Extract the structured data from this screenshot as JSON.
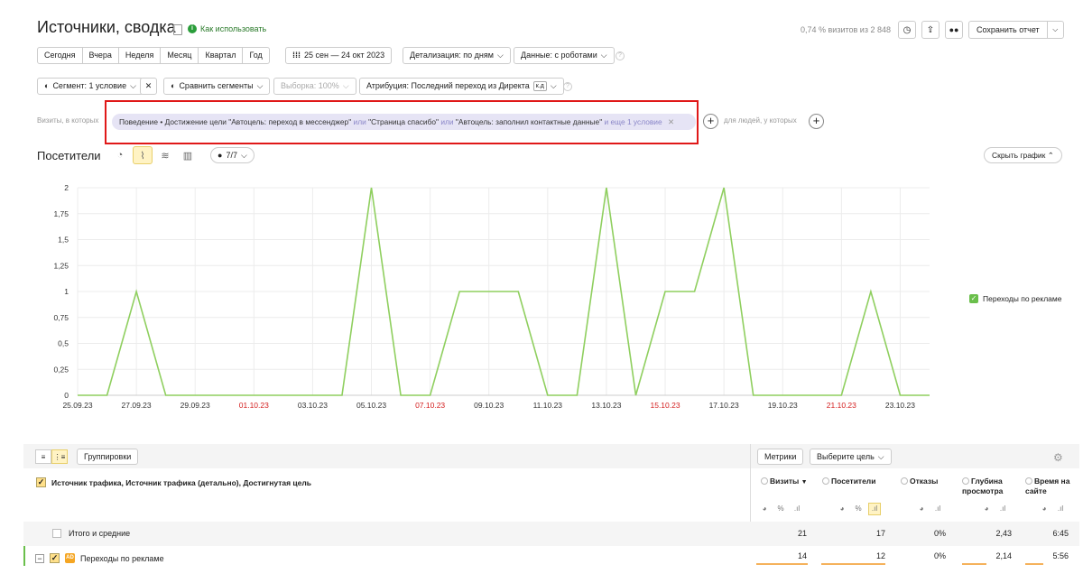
{
  "header": {
    "title": "Источники, сводка",
    "help_link": "Как использовать",
    "visits_note": "0,74 % визитов из 2 848",
    "save_label": "Сохранить отчет"
  },
  "periods": [
    "Сегодня",
    "Вчера",
    "Неделя",
    "Месяц",
    "Квартал",
    "Год"
  ],
  "date_range": "25 сен — 24 окт 2023",
  "detail": "Детализация: по дням",
  "data_mode": "Данные: с роботами",
  "segment": "Сегмент: 1 условие",
  "compare": "Сравнить сегменты",
  "sample": "Выборка: 100%",
  "attribution": "Атрибуция: Последний переход из Директа",
  "attribution_badge": "к.д",
  "filter": {
    "label": "Визиты, в которых",
    "chip_part1": "Поведение • Достижение цели \"Автоцель: переход в мессенджер\" ",
    "or1": "или",
    "chip_part2": " \"Страница спасибо\" ",
    "or2": "или",
    "chip_part3": " \"Автоцель: заполнил контактные данные\" ",
    "more": "и еще 1 условие",
    "people_label": "для людей, у которых"
  },
  "graph": {
    "title": "Посетители",
    "series_count": "7/7",
    "hide_label": "Скрыть график",
    "legend": "Переходы по рекламе",
    "line_color": "#8fcf5f"
  },
  "chart_data": {
    "type": "line",
    "ylim": [
      0,
      2
    ],
    "yticks": [
      "0",
      "0,25",
      "0,5",
      "0,75",
      "1",
      "1,25",
      "1,5",
      "1,75",
      "2"
    ],
    "xticks": [
      {
        "label": "25.09.23",
        "red": false
      },
      {
        "label": "27.09.23",
        "red": false
      },
      {
        "label": "29.09.23",
        "red": false
      },
      {
        "label": "01.10.23",
        "red": true
      },
      {
        "label": "03.10.23",
        "red": false
      },
      {
        "label": "05.10.23",
        "red": false
      },
      {
        "label": "07.10.23",
        "red": true
      },
      {
        "label": "09.10.23",
        "red": false
      },
      {
        "label": "11.10.23",
        "red": false
      },
      {
        "label": "13.10.23",
        "red": false
      },
      {
        "label": "15.10.23",
        "red": true
      },
      {
        "label": "17.10.23",
        "red": false
      },
      {
        "label": "19.10.23",
        "red": false
      },
      {
        "label": "21.10.23",
        "red": true
      },
      {
        "label": "23.10.23",
        "red": false
      }
    ],
    "series": [
      {
        "name": "Переходы по рекламе",
        "values": [
          0,
          0,
          1,
          0,
          0,
          0,
          0,
          0,
          0,
          0,
          2,
          0,
          0,
          1,
          1,
          1,
          0,
          0,
          2,
          0,
          1,
          1,
          2,
          0,
          0,
          0,
          0,
          1,
          0,
          0
        ]
      }
    ]
  },
  "table": {
    "groupings": "Группировки",
    "metrics_btn": "Метрики",
    "goal_btn": "Выберите цель",
    "dimension_header": "Источник трафика, Источник трафика (детально), Достигнутая цель",
    "columns": [
      "Визиты",
      "Посетители",
      "Отказы",
      "Глубина просмотра",
      "Время на сайте"
    ],
    "sort_mark": "▼",
    "total_label": "Итого и средние",
    "total": [
      "21",
      "17",
      "0%",
      "2,43",
      "6:45"
    ],
    "row_label": "Переходы по рекламе",
    "row": [
      "14",
      "12",
      "0%",
      "2,14",
      "5:56"
    ]
  }
}
